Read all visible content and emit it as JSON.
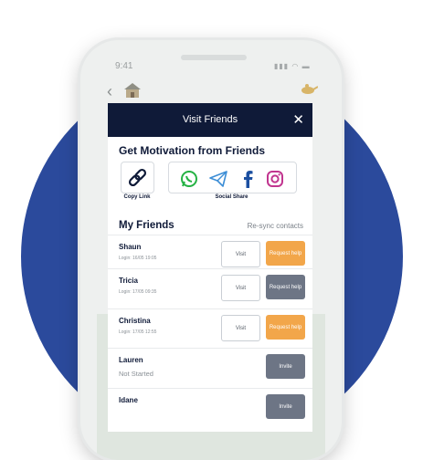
{
  "status_bar": {
    "time": "9:41"
  },
  "modal": {
    "title": "Visit Friends",
    "close_glyph": "✕",
    "motivation_heading": "Get Motivation from Friends",
    "copy_link_label": "Copy Link",
    "social_share_label": "Social Share",
    "social_icons": [
      "whatsapp-icon",
      "telegram-icon",
      "facebook-icon",
      "instagram-icon"
    ],
    "my_friends_heading": "My Friends",
    "resync_label": "Re-sync contacts",
    "friends": [
      {
        "name": "Shaun",
        "login": "Login: 16/05 19:05",
        "visit": "Visit",
        "action": "Request help",
        "action_color": "#f2a64a"
      },
      {
        "name": "Tricia",
        "login": "Login: 17/05 09:35",
        "visit": "Visit",
        "action": "Request help",
        "action_color": "#6d7585"
      },
      {
        "name": "Christina",
        "login": "Login: 17/05 12:55",
        "visit": "Visit",
        "action": "Request help",
        "action_color": "#f2a64a"
      },
      {
        "name": "Lauren",
        "status": "Not Started",
        "action": "Invite",
        "action_color": "#6d7585"
      },
      {
        "name": "Idane",
        "action": "Invite",
        "action_color": "#6d7585"
      }
    ]
  },
  "colors": {
    "background_circle": "#2b4a9c",
    "modal_header": "#0f1a38",
    "accent_orange": "#f2a64a",
    "muted_button": "#6d7585"
  }
}
